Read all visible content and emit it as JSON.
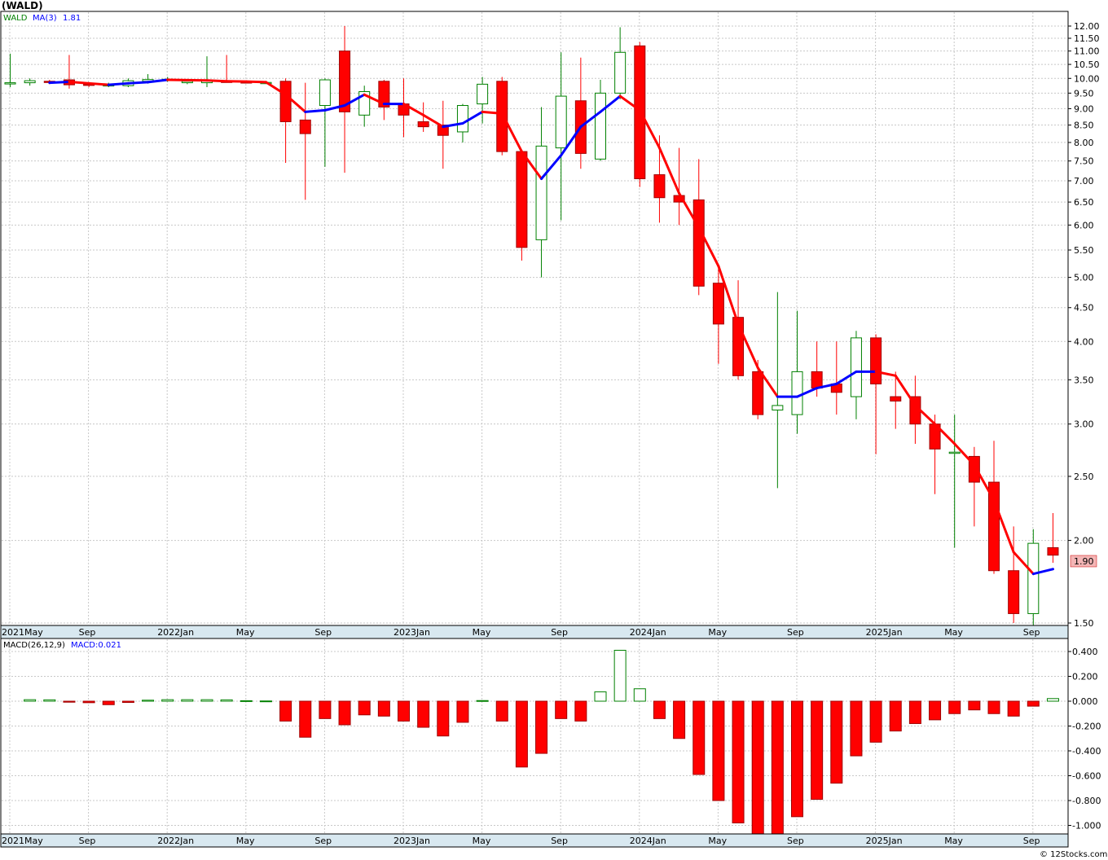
{
  "header": {
    "symbol_title": "(WALD)"
  },
  "legend": {
    "symbol": "WALD",
    "ma_label": "MA(3)",
    "ma_value": "1.81",
    "macd_label": "MACD(26,12,9)",
    "macd_value": "MACD:0.021"
  },
  "last_price_label": "1.90",
  "footer": {
    "credit": "© 12Stocks.com"
  },
  "colors": {
    "up": "#008000",
    "down": "#ff0000",
    "ma_up": "#0000ff",
    "ma_down": "#ff0000",
    "grid": "#c8c8c8",
    "axis_band": "#d8e8f0",
    "price_tag": "#f4b6b6"
  },
  "chart_data": [
    {
      "type": "candlestick",
      "scale": "log",
      "ylim": [
        1.5,
        12.0
      ],
      "y_ticks": [
        "12.00",
        "11.50",
        "11.00",
        "10.50",
        "10.00",
        "9.50",
        "9.00",
        "8.50",
        "8.00",
        "7.50",
        "7.00",
        "6.50",
        "6.00",
        "5.50",
        "5.00",
        "4.50",
        "4.00",
        "3.50",
        "3.00",
        "2.50",
        "2.00",
        "1.50"
      ],
      "x_labels": [
        "2021May",
        "Sep",
        "2022Jan",
        "May",
        "Sep",
        "2023Jan",
        "May",
        "Sep",
        "2024Jan",
        "May",
        "Sep",
        "2025Jan",
        "May",
        "Sep"
      ],
      "candles": [
        {
          "o": 9.85,
          "h": 10.9,
          "l": 9.7,
          "c": 9.85
        },
        {
          "o": 9.85,
          "h": 10.0,
          "l": 9.75,
          "c": 9.92
        },
        {
          "o": 9.9,
          "h": 9.95,
          "l": 9.8,
          "c": 9.88
        },
        {
          "o": 9.95,
          "h": 10.85,
          "l": 9.65,
          "c": 9.78
        },
        {
          "o": 9.8,
          "h": 9.85,
          "l": 9.7,
          "c": 9.78
        },
        {
          "o": 9.75,
          "h": 9.85,
          "l": 9.7,
          "c": 9.78
        },
        {
          "o": 9.75,
          "h": 10.0,
          "l": 9.7,
          "c": 9.92
        },
        {
          "o": 9.9,
          "h": 10.15,
          "l": 9.82,
          "c": 9.96
        },
        {
          "o": 9.95,
          "h": 10.05,
          "l": 9.88,
          "c": 9.97
        },
        {
          "o": 9.85,
          "h": 9.95,
          "l": 9.8,
          "c": 9.9
        },
        {
          "o": 9.85,
          "h": 10.8,
          "l": 9.7,
          "c": 9.92
        },
        {
          "o": 9.9,
          "h": 10.85,
          "l": 9.85,
          "c": 9.88
        },
        {
          "o": 9.88,
          "h": 9.9,
          "l": 9.85,
          "c": 9.87
        },
        {
          "o": 9.85,
          "h": 9.9,
          "l": 9.82,
          "c": 9.86
        },
        {
          "o": 9.9,
          "h": 10.0,
          "l": 7.45,
          "c": 8.6
        },
        {
          "o": 8.65,
          "h": 9.85,
          "l": 6.55,
          "c": 8.25
        },
        {
          "o": 9.1,
          "h": 10.0,
          "l": 7.35,
          "c": 9.95
        },
        {
          "o": 11.0,
          "h": 12.0,
          "l": 7.2,
          "c": 8.9
        },
        {
          "o": 8.8,
          "h": 9.75,
          "l": 8.45,
          "c": 9.55
        },
        {
          "o": 9.9,
          "h": 9.95,
          "l": 8.65,
          "c": 9.05
        },
        {
          "o": 9.15,
          "h": 10.0,
          "l": 8.15,
          "c": 8.8
        },
        {
          "o": 8.6,
          "h": 9.2,
          "l": 8.3,
          "c": 8.45
        },
        {
          "o": 8.5,
          "h": 9.25,
          "l": 7.3,
          "c": 8.2
        },
        {
          "o": 8.3,
          "h": 9.15,
          "l": 8.0,
          "c": 9.1
        },
        {
          "o": 9.15,
          "h": 10.05,
          "l": 8.55,
          "c": 9.8
        },
        {
          "o": 9.9,
          "h": 10.05,
          "l": 7.65,
          "c": 7.75
        },
        {
          "o": 7.75,
          "h": 7.8,
          "l": 5.3,
          "c": 5.55
        },
        {
          "o": 5.7,
          "h": 9.05,
          "l": 5.0,
          "c": 7.9
        },
        {
          "o": 7.85,
          "h": 10.95,
          "l": 6.1,
          "c": 9.4
        },
        {
          "o": 9.25,
          "h": 10.75,
          "l": 7.3,
          "c": 7.7
        },
        {
          "o": 7.55,
          "h": 9.95,
          "l": 7.5,
          "c": 9.5
        },
        {
          "o": 9.5,
          "h": 11.95,
          "l": 9.3,
          "c": 10.95
        },
        {
          "o": 11.2,
          "h": 11.35,
          "l": 6.85,
          "c": 7.05
        },
        {
          "o": 7.15,
          "h": 8.2,
          "l": 6.05,
          "c": 6.6
        },
        {
          "o": 6.65,
          "h": 7.85,
          "l": 6.0,
          "c": 6.5
        },
        {
          "o": 6.55,
          "h": 7.55,
          "l": 4.7,
          "c": 4.85
        },
        {
          "o": 4.9,
          "h": 5.2,
          "l": 3.7,
          "c": 4.25
        },
        {
          "o": 4.35,
          "h": 4.95,
          "l": 3.5,
          "c": 3.55
        },
        {
          "o": 3.6,
          "h": 3.75,
          "l": 3.05,
          "c": 3.1
        },
        {
          "o": 3.15,
          "h": 4.75,
          "l": 2.4,
          "c": 3.2
        },
        {
          "o": 3.1,
          "h": 4.45,
          "l": 2.9,
          "c": 3.6
        },
        {
          "o": 3.6,
          "h": 4.0,
          "l": 3.3,
          "c": 3.4
        },
        {
          "o": 3.45,
          "h": 4.0,
          "l": 3.1,
          "c": 3.35
        },
        {
          "o": 3.3,
          "h": 4.15,
          "l": 3.05,
          "c": 4.05
        },
        {
          "o": 4.05,
          "h": 4.1,
          "l": 2.7,
          "c": 3.45
        },
        {
          "o": 3.3,
          "h": 3.6,
          "l": 2.95,
          "c": 3.25
        },
        {
          "o": 3.3,
          "h": 3.55,
          "l": 2.8,
          "c": 3.0
        },
        {
          "o": 3.0,
          "h": 3.1,
          "l": 2.35,
          "c": 2.75
        },
        {
          "o": 2.72,
          "h": 3.1,
          "l": 1.95,
          "c": 2.72
        },
        {
          "o": 2.68,
          "h": 2.77,
          "l": 2.1,
          "c": 2.45
        },
        {
          "o": 2.45,
          "h": 2.83,
          "l": 1.78,
          "c": 1.8
        },
        {
          "o": 1.8,
          "h": 2.1,
          "l": 1.5,
          "c": 1.55
        },
        {
          "o": 1.55,
          "h": 2.08,
          "l": 1.47,
          "c": 1.98
        },
        {
          "o": 1.95,
          "h": 2.2,
          "l": 1.85,
          "c": 1.9
        }
      ],
      "ma3": [
        null,
        null,
        9.85,
        9.88,
        9.83,
        9.78,
        9.83,
        9.87,
        9.95,
        9.94,
        9.93,
        9.9,
        9.89,
        9.87,
        9.45,
        8.9,
        8.95,
        9.1,
        9.45,
        9.15,
        9.15,
        8.8,
        8.45,
        8.55,
        8.9,
        8.85,
        7.75,
        7.05,
        7.65,
        8.45,
        8.9,
        9.4,
        8.95,
        7.85,
        6.7,
        5.95,
        5.2,
        4.25,
        3.65,
        3.3,
        3.3,
        3.4,
        3.45,
        3.6,
        3.6,
        3.55,
        3.2,
        3.0,
        2.8,
        2.6,
        2.3,
        1.92,
        1.78,
        1.81
      ]
    },
    {
      "type": "bar",
      "title": "MACD(26,12,9)",
      "ylim": [
        -1.07,
        0.45
      ],
      "y_ticks": [
        "0.400",
        "0.200",
        "0.000",
        "-0.200",
        "-0.400",
        "-0.600",
        "-0.800",
        "-1.000"
      ],
      "values": [
        0.012,
        0.011,
        -0.008,
        -0.012,
        -0.028,
        -0.01,
        0.008,
        0.012,
        0.012,
        0.012,
        0.011,
        0.004,
        0.002,
        -0.16,
        -0.29,
        -0.14,
        -0.19,
        -0.11,
        -0.12,
        -0.16,
        -0.21,
        -0.28,
        -0.17,
        0.005,
        -0.16,
        -0.53,
        -0.42,
        -0.14,
        -0.16,
        0.075,
        0.41,
        0.1,
        -0.14,
        -0.3,
        -0.59,
        -0.8,
        -0.98,
        -1.07,
        -1.07,
        -0.93,
        -0.79,
        -0.66,
        -0.44,
        -0.33,
        -0.24,
        -0.18,
        -0.15,
        -0.1,
        -0.07,
        -0.1,
        -0.12,
        -0.04,
        0.021
      ]
    }
  ]
}
